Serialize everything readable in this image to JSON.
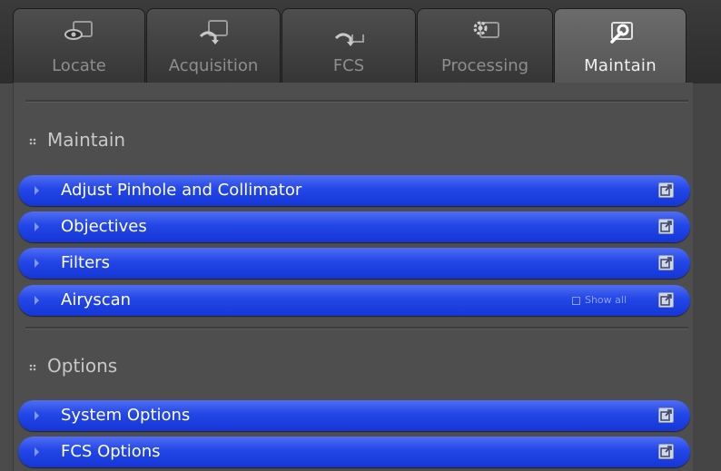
{
  "tabs": [
    {
      "label": "Locate",
      "icon": "locate-eye-icon",
      "active": false
    },
    {
      "label": "Acquisition",
      "icon": "acquisition-arrow-icon",
      "active": false
    },
    {
      "label": "FCS",
      "icon": "fcs-arrow-icon",
      "active": false
    },
    {
      "label": "Processing",
      "icon": "processing-gear-icon",
      "active": false
    },
    {
      "label": "Maintain",
      "icon": "maintain-wrench-icon",
      "active": true
    }
  ],
  "sections": {
    "maintain": {
      "title": "Maintain",
      "items": [
        {
          "label": "Adjust Pinhole and Collimator"
        },
        {
          "label": "Objectives"
        },
        {
          "label": "Filters"
        },
        {
          "label": "Airyscan",
          "show_all": "Show all"
        }
      ]
    },
    "options": {
      "title": "Options",
      "items": [
        {
          "label": "System Options"
        },
        {
          "label": "FCS Options"
        }
      ]
    }
  },
  "colors": {
    "bar": "#2346e6",
    "background": "#4b4b4b",
    "tab_active": "#5f5f5f"
  }
}
